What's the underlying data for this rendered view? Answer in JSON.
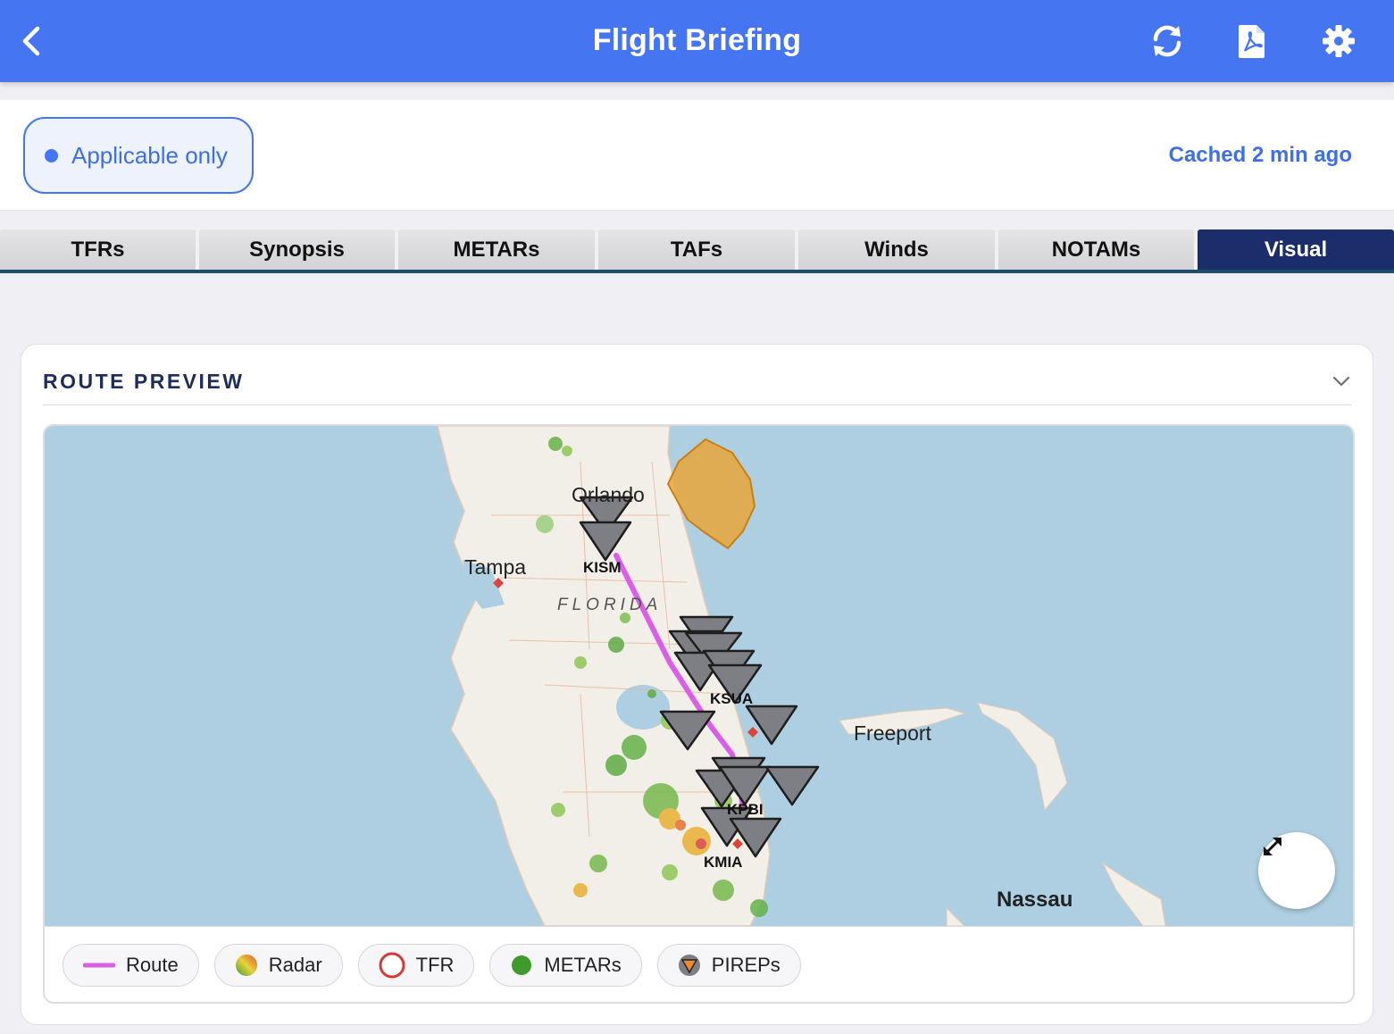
{
  "header": {
    "title": "Flight Briefing",
    "back_icon": "chevron-left-icon",
    "actions": [
      {
        "icon": "refresh-icon"
      },
      {
        "icon": "pdf-icon"
      },
      {
        "icon": "gear-icon"
      }
    ],
    "color": "#4575f0"
  },
  "filter": {
    "applicable_label": "Applicable only",
    "cached_label": "Cached 2 min ago"
  },
  "tabs": [
    {
      "label": "TFRs",
      "active": false
    },
    {
      "label": "Synopsis",
      "active": false
    },
    {
      "label": "METARs",
      "active": false
    },
    {
      "label": "TAFs",
      "active": false
    },
    {
      "label": "Winds",
      "active": false
    },
    {
      "label": "NOTAMs",
      "active": false
    },
    {
      "label": "Visual",
      "active": true
    }
  ],
  "card": {
    "title": "ROUTE PREVIEW"
  },
  "map": {
    "labels": {
      "orlando": "Orlando",
      "tampa": "Tampa",
      "florida": "FLORIDA",
      "freeport": "Freeport",
      "nassau": "Nassau",
      "kism": "KISM",
      "ksua": "KSUA",
      "kpbi": "KPBI",
      "kmia": "KMIA"
    },
    "route_color": "#d95fe6",
    "tfr_color": "#e8a43a"
  },
  "legend": [
    {
      "label": "Route",
      "icon": "route-line-icon"
    },
    {
      "label": "Radar",
      "icon": "radar-icon"
    },
    {
      "label": "TFR",
      "icon": "tfr-circle-icon"
    },
    {
      "label": "METARs",
      "icon": "metar-dot-icon"
    },
    {
      "label": "PIREPs",
      "icon": "pirep-triangle-icon"
    }
  ]
}
